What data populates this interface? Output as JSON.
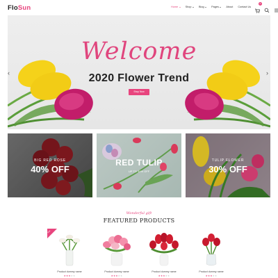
{
  "header": {
    "logo_part1": "Flo",
    "logo_part2": "Sun",
    "nav": [
      {
        "label": "Home",
        "dropdown": true,
        "active": true
      },
      {
        "label": "Shop",
        "dropdown": true
      },
      {
        "label": "Blog",
        "dropdown": true
      },
      {
        "label": "Pages",
        "dropdown": true
      },
      {
        "label": "About",
        "dropdown": false
      },
      {
        "label": "Contact Us",
        "dropdown": false
      }
    ],
    "cart_count": "0",
    "icons": [
      "cart-icon",
      "search-icon",
      "menu-icon"
    ]
  },
  "hero": {
    "welcome": "Welcome",
    "subtitle": "2020 Flower Trend",
    "button": "Shop Now",
    "prev": "‹",
    "next": "›"
  },
  "banners": [
    {
      "title": "BIG RED ROSE",
      "offer": "40% OFF"
    },
    {
      "title": "RED TULIP",
      "offer": "UP TO 30% OFF"
    },
    {
      "title": "TULIP FLOWER",
      "offer": "30% OFF"
    }
  ],
  "featured": {
    "script": "Wonderful gift",
    "title": "FEATURED PRODUCTS"
  },
  "products": [
    {
      "name": "Product dummy name",
      "rating": 3,
      "sale": "Sale"
    },
    {
      "name": "Product dummy name",
      "rating": 3
    },
    {
      "name": "Product dummy name",
      "rating": 3
    },
    {
      "name": "Product dummy name",
      "rating": 3
    }
  ],
  "colors": {
    "accent": "#e8457e",
    "text": "#222222",
    "hero_bg": "#eeeeee"
  }
}
